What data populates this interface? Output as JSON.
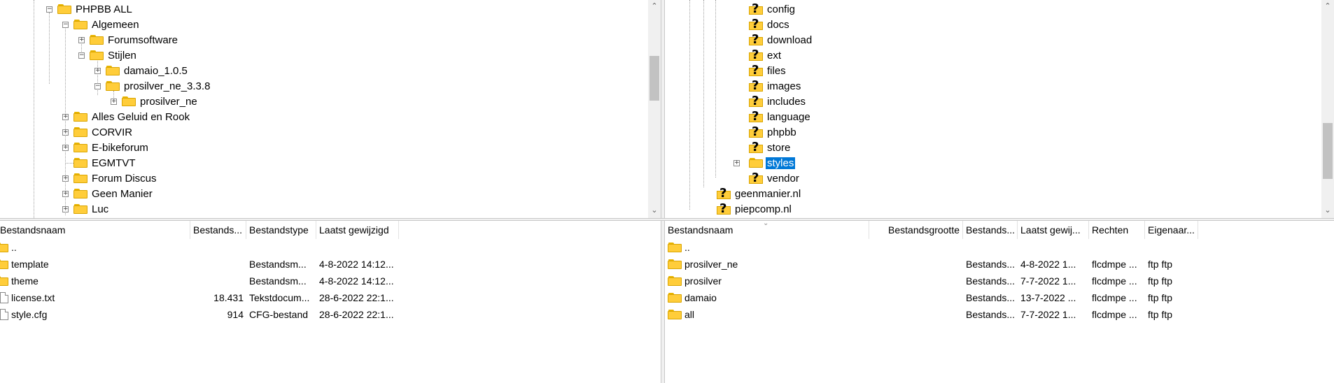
{
  "left_tree": {
    "items": [
      {
        "label": "PHPBB ALL",
        "expander": "−"
      },
      {
        "label": "Algemeen",
        "expander": "−"
      },
      {
        "label": "Forumsoftware",
        "expander": "+"
      },
      {
        "label": "Stijlen",
        "expander": "−"
      },
      {
        "label": "damaio_1.0.5",
        "expander": "+"
      },
      {
        "label": "prosilver_ne_3.3.8",
        "expander": "−"
      },
      {
        "label": "prosilver_ne",
        "expander": "+"
      },
      {
        "label": "Alles Geluid en Rook",
        "expander": "+"
      },
      {
        "label": "CORVIR",
        "expander": "+"
      },
      {
        "label": "E-bikeforum",
        "expander": "+"
      },
      {
        "label": "EGMTVT",
        "expander": ""
      },
      {
        "label": "Forum Discus",
        "expander": "+"
      },
      {
        "label": "Geen Manier",
        "expander": "+"
      },
      {
        "label": "Luc",
        "expander": "+"
      }
    ]
  },
  "right_tree": {
    "items": [
      {
        "label": "config",
        "icon": "question-folder-icon"
      },
      {
        "label": "docs",
        "icon": "question-folder-icon"
      },
      {
        "label": "download",
        "icon": "question-folder-icon"
      },
      {
        "label": "ext",
        "icon": "question-folder-icon"
      },
      {
        "label": "files",
        "icon": "question-folder-icon"
      },
      {
        "label": "images",
        "icon": "question-folder-icon"
      },
      {
        "label": "includes",
        "icon": "question-folder-icon"
      },
      {
        "label": "language",
        "icon": "question-folder-icon"
      },
      {
        "label": "phpbb",
        "icon": "question-folder-icon"
      },
      {
        "label": "store",
        "icon": "question-folder-icon"
      },
      {
        "label": "styles",
        "icon": "folder-icon",
        "selected": true,
        "expander": "+"
      },
      {
        "label": "vendor",
        "icon": "question-folder-icon"
      },
      {
        "label": "geenmanier.nl",
        "icon": "question-folder-icon"
      },
      {
        "label": "piepcomp.nl",
        "icon": "question-folder-icon"
      }
    ]
  },
  "local_list": {
    "headers": {
      "name": "Bestandsnaam",
      "size": "Bestands...",
      "type": "Bestandstype",
      "modified": "Laatst gewijzigd"
    },
    "rows": [
      {
        "name": "..",
        "size": "",
        "type": "",
        "modified": "",
        "icon": "folder-icon"
      },
      {
        "name": "template",
        "size": "",
        "type": "Bestandsm...",
        "modified": "4-8-2022 14:12...",
        "icon": "folder-icon"
      },
      {
        "name": "theme",
        "size": "",
        "type": "Bestandsm...",
        "modified": "4-8-2022 14:12...",
        "icon": "folder-icon"
      },
      {
        "name": "license.txt",
        "size": "18.431",
        "type": "Tekstdocum...",
        "modified": "28-6-2022 22:1...",
        "icon": "file-icon"
      },
      {
        "name": "style.cfg",
        "size": "914",
        "type": "CFG-bestand",
        "modified": "28-6-2022 22:1...",
        "icon": "file-icon"
      }
    ]
  },
  "remote_list": {
    "headers": {
      "name": "Bestandsnaam",
      "size": "Bestandsgrootte",
      "type": "Bestands...",
      "modified": "Laatst gewij...",
      "perms": "Rechten",
      "owner": "Eigenaar..."
    },
    "rows": [
      {
        "name": "..",
        "size": "",
        "type": "",
        "modified": "",
        "perms": "",
        "owner": ""
      },
      {
        "name": "prosilver_ne",
        "size": "",
        "type": "Bestands...",
        "modified": "4-8-2022 1...",
        "perms": "flcdmpe ...",
        "owner": "ftp ftp"
      },
      {
        "name": "prosilver",
        "size": "",
        "type": "Bestands...",
        "modified": "7-7-2022 1...",
        "perms": "flcdmpe ...",
        "owner": "ftp ftp"
      },
      {
        "name": "damaio",
        "size": "",
        "type": "Bestands...",
        "modified": "13-7-2022 ...",
        "perms": "flcdmpe ...",
        "owner": "ftp ftp"
      },
      {
        "name": "all",
        "size": "",
        "type": "Bestands...",
        "modified": "7-7-2022 1...",
        "perms": "flcdmpe ...",
        "owner": "ftp ftp"
      }
    ]
  },
  "colors": {
    "selection": "#0078d7",
    "folder": "#ffcd3a",
    "folder_border": "#d9a400"
  }
}
